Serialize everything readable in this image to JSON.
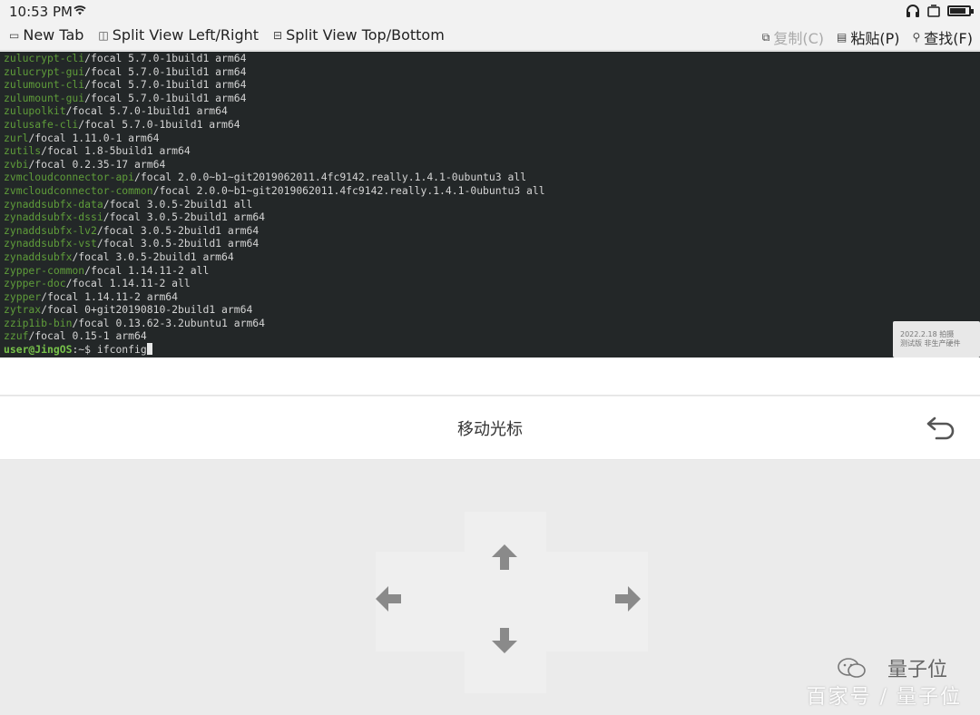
{
  "status_bar": {
    "time": "10:53 PM",
    "battery_level": 0.85
  },
  "toolbar": {
    "new_tab": "New Tab",
    "split_lr": "Split View Left/Right",
    "split_tb": "Split View Top/Bottom",
    "copy": "复制(C)",
    "paste": "粘贴(P)",
    "find": "查找(F)"
  },
  "terminal": {
    "lines": [
      {
        "pkg": "zulucrypt-cli",
        "rest": "/focal 5.7.0-1build1 arm64"
      },
      {
        "pkg": "zulucrypt-gui",
        "rest": "/focal 5.7.0-1build1 arm64"
      },
      {
        "pkg": "zulumount-cli",
        "rest": "/focal 5.7.0-1build1 arm64"
      },
      {
        "pkg": "zulumount-gui",
        "rest": "/focal 5.7.0-1build1 arm64"
      },
      {
        "pkg": "zulupolkit",
        "rest": "/focal 5.7.0-1build1 arm64"
      },
      {
        "pkg": "zulusafe-cli",
        "rest": "/focal 5.7.0-1build1 arm64"
      },
      {
        "pkg": "zurl",
        "rest": "/focal 1.11.0-1 arm64"
      },
      {
        "pkg": "zutils",
        "rest": "/focal 1.8-5build1 arm64"
      },
      {
        "pkg": "zvbi",
        "rest": "/focal 0.2.35-17 arm64"
      },
      {
        "pkg": "zvmcloudconnector-api",
        "rest": "/focal 2.0.0~b1~git2019062011.4fc9142.really.1.4.1-0ubuntu3 all"
      },
      {
        "pkg": "zvmcloudconnector-common",
        "rest": "/focal 2.0.0~b1~git2019062011.4fc9142.really.1.4.1-0ubuntu3 all"
      },
      {
        "pkg": "zynaddsubfx-data",
        "rest": "/focal 3.0.5-2build1 all"
      },
      {
        "pkg": "zynaddsubfx-dssi",
        "rest": "/focal 3.0.5-2build1 arm64"
      },
      {
        "pkg": "zynaddsubfx-lv2",
        "rest": "/focal 3.0.5-2build1 arm64"
      },
      {
        "pkg": "zynaddsubfx-vst",
        "rest": "/focal 3.0.5-2build1 arm64"
      },
      {
        "pkg": "zynaddsubfx",
        "rest": "/focal 3.0.5-2build1 arm64"
      },
      {
        "pkg": "zypper-common",
        "rest": "/focal 1.14.11-2 all"
      },
      {
        "pkg": "zypper-doc",
        "rest": "/focal 1.14.11-2 all"
      },
      {
        "pkg": "zypper",
        "rest": "/focal 1.14.11-2 arm64"
      },
      {
        "pkg": "zytrax",
        "rest": "/focal 0+git20190810-2build1 arm64"
      },
      {
        "pkg": "zzip1ib-bin",
        "rest": "/focal 0.13.62-3.2ubuntu1 arm64"
      },
      {
        "pkg": "zzuf",
        "rest": "/focal 0.15-1 arm64"
      }
    ],
    "prompt_user": "user@JingOS",
    "prompt_path": ":~$ ",
    "command": "ifconfig"
  },
  "badge": {
    "line1": "2022.2.18 拍摄",
    "line2": "测试版 非生产硬件"
  },
  "cursor_panel": {
    "title": "移动光标"
  },
  "dpad": {
    "up": "arrow-up",
    "down": "arrow-down",
    "left": "arrow-left",
    "right": "arrow-right"
  },
  "watermark": {
    "brand": "量子位",
    "source": "百家号 / 量子位"
  }
}
